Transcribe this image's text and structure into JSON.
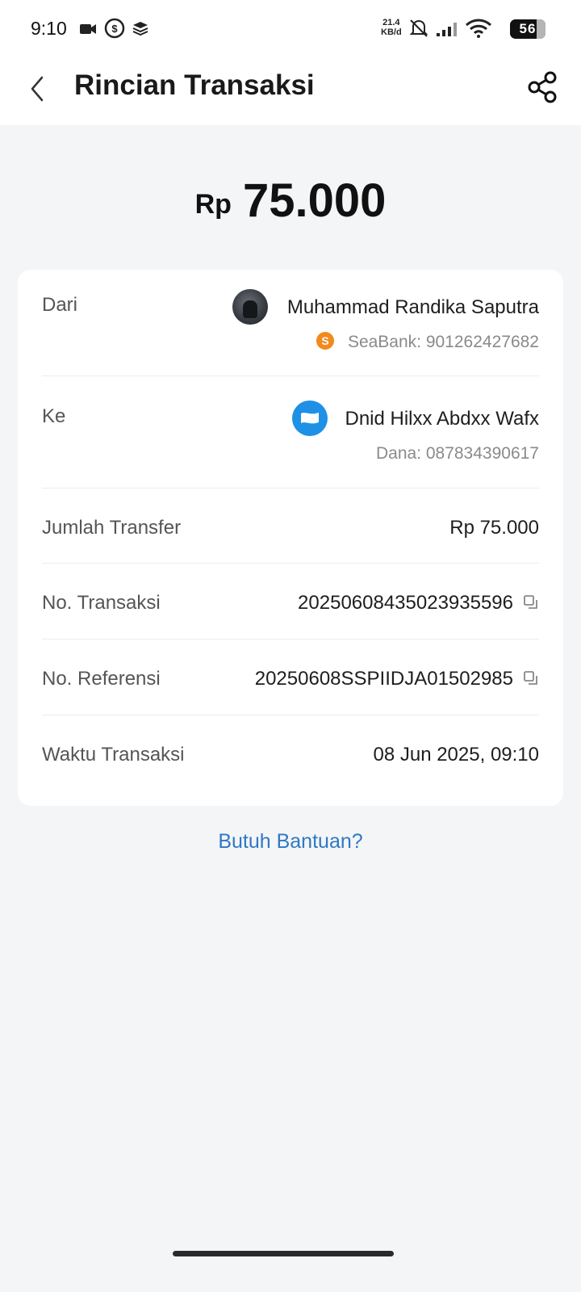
{
  "status_bar": {
    "time": "9:10",
    "net_speed_value": "21.4",
    "net_speed_unit": "KB/d",
    "battery": "56",
    "icons": [
      "video-icon",
      "seamoney-icon",
      "layers-icon",
      "bell-off-icon",
      "signal-icon",
      "wifi-icon",
      "battery-icon"
    ]
  },
  "header": {
    "title": "Rincian Transaksi",
    "back_icon": "chevron-left-icon",
    "share_icon": "share-icon"
  },
  "amount": {
    "currency": "Rp",
    "value": "75.000"
  },
  "details": {
    "from": {
      "label": "Dari",
      "name": "Muhammad Randika Saputra",
      "account": "SeaBank: 901262427682"
    },
    "to": {
      "label": "Ke",
      "name": "Dnid Hilxx Abdxx Wafx",
      "account": "Dana: 087834390617"
    },
    "transfer_amount": {
      "label": "Jumlah Transfer",
      "value": "Rp 75.000"
    },
    "transaction_no": {
      "label": "No. Transaksi",
      "value": "20250608435023935596"
    },
    "reference_no": {
      "label": "No. Referensi",
      "value": "20250608SSPIIDJA01502985"
    },
    "transaction_time": {
      "label": "Waktu Transaksi",
      "value": "08 Jun 2025, 09:10"
    }
  },
  "help": {
    "label": "Butuh Bantuan?"
  },
  "colors": {
    "accent_link": "#2f78c4",
    "background": "#f4f5f7",
    "dana_blue": "#1e90e6",
    "seabank_orange": "#f28a1c"
  }
}
